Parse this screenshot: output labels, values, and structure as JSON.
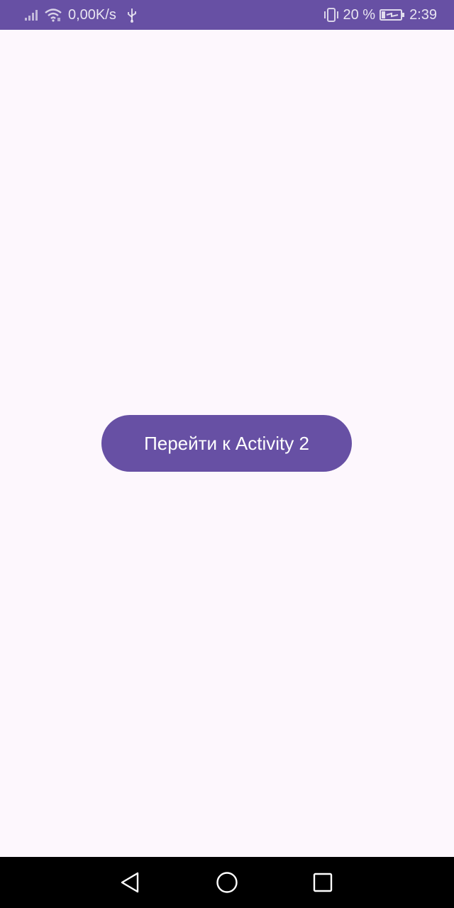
{
  "status_bar": {
    "net_speed": "0,00K/s",
    "battery_percent": "20 %",
    "time": "2:39",
    "icons": {
      "signal": "signal-bars-icon",
      "wifi": "wifi-icon",
      "usb": "usb-icon",
      "vibrate": "vibrate-icon",
      "battery": "battery-charging-icon"
    }
  },
  "main": {
    "button_label": "Перейти к Activity 2"
  },
  "nav_bar": {
    "icons": {
      "back": "back-triangle-icon",
      "home": "home-circle-icon",
      "recents": "recents-square-icon"
    }
  },
  "colors": {
    "accent": "#6750A4",
    "background": "#FDF7FD",
    "nav_background": "#000000",
    "button_text": "#FFFFFF"
  }
}
